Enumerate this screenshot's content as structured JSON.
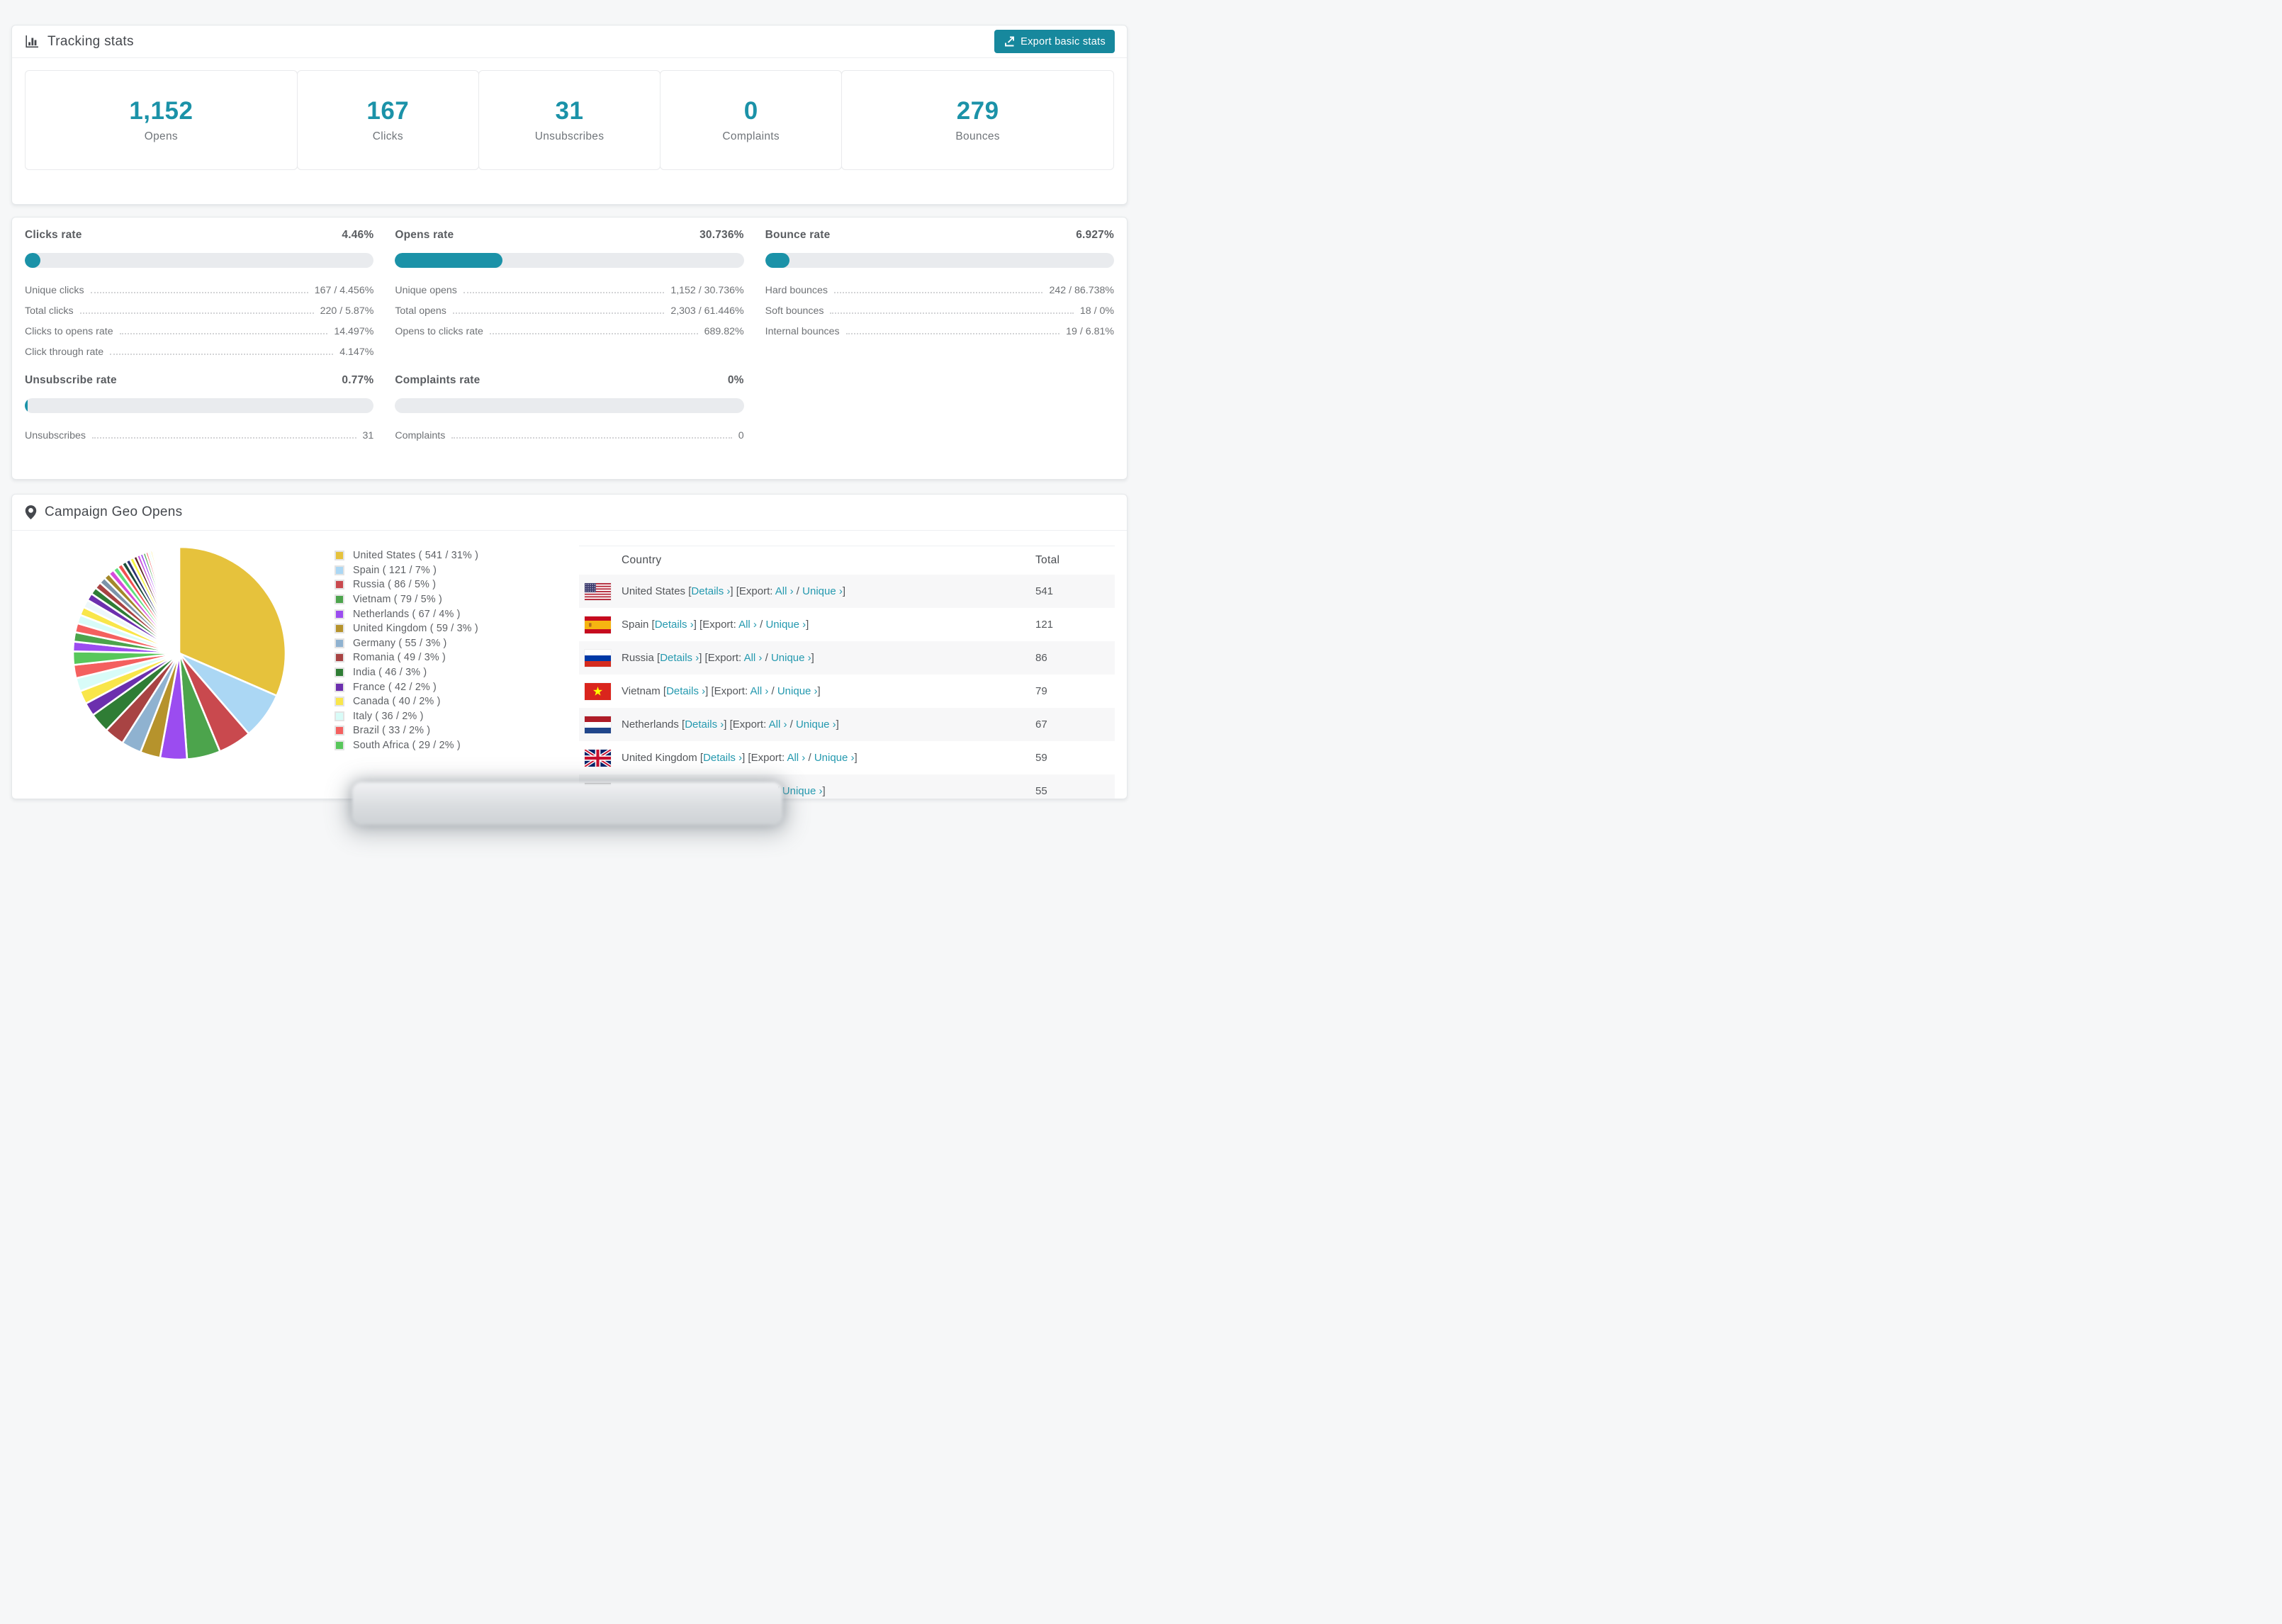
{
  "theme": {
    "accent": "#1b92a8",
    "button_bg": "#17889d",
    "link": "#2499af",
    "bar_track": "#e9ebee",
    "row_stripe": "#f7f7f8"
  },
  "header": {
    "icon": "bar-chart-icon",
    "title": "Tracking stats",
    "export_button": {
      "icon": "export-icon",
      "label": "Export basic stats"
    }
  },
  "summary_stats": [
    {
      "value": "1,152",
      "label": "Opens"
    },
    {
      "value": "167",
      "label": "Clicks"
    },
    {
      "value": "31",
      "label": "Unsubscribes"
    },
    {
      "value": "0",
      "label": "Complaints"
    },
    {
      "value": "279",
      "label": "Bounces"
    }
  ],
  "rate_panels": [
    {
      "title": "Clicks rate",
      "value": "4.46%",
      "percent": 4.46,
      "rows": [
        {
          "label": "Unique clicks",
          "value": "167 / 4.456%"
        },
        {
          "label": "Total clicks",
          "value": "220 / 5.87%"
        },
        {
          "label": "Clicks to opens rate",
          "value": "14.497%"
        },
        {
          "label": "Click through rate",
          "value": "4.147%"
        }
      ]
    },
    {
      "title": "Opens rate",
      "value": "30.736%",
      "percent": 30.736,
      "rows": [
        {
          "label": "Unique opens",
          "value": "1,152 / 30.736%"
        },
        {
          "label": "Total opens",
          "value": "2,303 / 61.446%"
        },
        {
          "label": "Opens to clicks rate",
          "value": "689.82%"
        }
      ]
    },
    {
      "title": "Bounce rate",
      "value": "6.927%",
      "percent": 6.927,
      "rows": [
        {
          "label": "Hard bounces",
          "value": "242 / 86.738%"
        },
        {
          "label": "Soft bounces",
          "value": "18 / 0%"
        },
        {
          "label": "Internal bounces",
          "value": "19 / 6.81%"
        }
      ]
    },
    {
      "title": "Unsubscribe rate",
      "value": "0.77%",
      "percent": 0.77,
      "rows": [
        {
          "label": "Unsubscribes",
          "value": "31"
        }
      ]
    },
    {
      "title": "Complaints rate",
      "value": "0%",
      "percent": 0,
      "rows": [
        {
          "label": "Complaints",
          "value": "0"
        }
      ]
    }
  ],
  "geo": {
    "icon": "map-pin-icon",
    "title": "Campaign Geo Opens",
    "table": {
      "columns": [
        "Country",
        "Total"
      ],
      "link_labels": {
        "details": "Details ›",
        "export": "Export:",
        "all": "All ›",
        "unique": "Unique ›"
      },
      "rows": [
        {
          "flag": "us",
          "country": "United States",
          "total": "541"
        },
        {
          "flag": "es",
          "country": "Spain",
          "total": "121"
        },
        {
          "flag": "ru",
          "country": "Russia",
          "total": "86"
        },
        {
          "flag": "vn",
          "country": "Vietnam",
          "total": "79"
        },
        {
          "flag": "nl",
          "country": "Netherlands",
          "total": "67"
        },
        {
          "flag": "gb",
          "country": "United Kingdom",
          "total": "59"
        },
        {
          "flag": "de",
          "country": "Germany",
          "total": "55"
        }
      ]
    }
  },
  "chart_data": {
    "type": "pie",
    "title": "Campaign Geo Opens",
    "legend_position": "right",
    "start_angle_deg": 0,
    "direction": "clockwise",
    "categories": [
      "United States",
      "Spain",
      "Russia",
      "Vietnam",
      "Netherlands",
      "United Kingdom",
      "Germany",
      "Romania",
      "India",
      "France",
      "Canada",
      "Italy",
      "Brazil",
      "South Africa"
    ],
    "values": [
      541,
      121,
      86,
      79,
      67,
      59,
      55,
      49,
      46,
      42,
      40,
      36,
      33,
      29
    ],
    "percents": [
      31,
      7,
      5,
      5,
      4,
      3,
      3,
      3,
      3,
      2,
      2,
      2,
      2,
      2
    ],
    "percent_labels": [
      "31%",
      "7%",
      "5%",
      "5%",
      "4%",
      "3%",
      "3%",
      "3%",
      "3%",
      "2%",
      "2%",
      "2%",
      "2%",
      "2%"
    ],
    "colors": [
      "#e6c23c",
      "#abd7f4",
      "#c9494e",
      "#4ca44c",
      "#9b4cf0",
      "#b6932c",
      "#8fb2d0",
      "#a84343",
      "#2f7d35",
      "#6c2fae",
      "#f9e64a",
      "#d8fcf8",
      "#f4605f",
      "#58c75b"
    ],
    "small_slices": {
      "weights": [
        1.45,
        1.4,
        1.35,
        1.3,
        1.25,
        1.2,
        1.1,
        1.05,
        1,
        0.95,
        0.9,
        0.85,
        0.8,
        0.75,
        0.7,
        0.65,
        0.6,
        0.55,
        0.5,
        0.46,
        0.42,
        0.38,
        0.35,
        0.32,
        0.29,
        0.26,
        0.23,
        0.2,
        0.18,
        0.16,
        0.14,
        0.12,
        0.1,
        0.09,
        0.08,
        0.07,
        0.06,
        0.05,
        0.04,
        0.03
      ],
      "palette": [
        "#9b4cf0",
        "#4ca44c",
        "#f4605f",
        "#d8fcf8",
        "#f9e64a",
        "#edf7fb",
        "#6c2fae",
        "#2f7d35",
        "#a84343",
        "#7d94aa",
        "#a3882a",
        "#d64bdb",
        "#5fe07c",
        "#f05050",
        "#1e4f3a",
        "#2b3170",
        "#f6f642",
        "#5d2626",
        "#c94fe0"
      ]
    }
  }
}
